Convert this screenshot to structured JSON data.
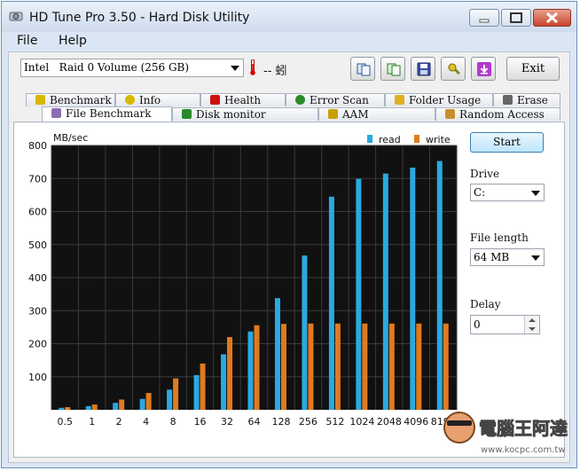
{
  "window": {
    "title": "HD Tune Pro 3.50 - Hard Disk Utility"
  },
  "menu": [
    "File",
    "Help"
  ],
  "toolbar": {
    "drive_select": "Intel   Raid 0 Volume (256 GB)",
    "temperature": "-- 蚓",
    "exit_label": "Exit",
    "tools": [
      "copy-info-icon",
      "copy-screen-icon",
      "save-icon",
      "options-icon",
      "download-icon"
    ]
  },
  "tabs": {
    "row1": [
      {
        "label": "Benchmark",
        "icon": "benchmark-icon",
        "color": "#d8b800"
      },
      {
        "label": "Info",
        "icon": "info-icon",
        "color": "#d8b800"
      },
      {
        "label": "Health",
        "icon": "health-icon",
        "color": "#d01010"
      },
      {
        "label": "Error Scan",
        "icon": "error-scan-icon",
        "color": "#2a8a2a"
      },
      {
        "label": "Folder Usage",
        "icon": "folder-icon",
        "color": "#e0b020"
      },
      {
        "label": "Erase",
        "icon": "erase-icon",
        "color": "#666666"
      }
    ],
    "row2": [
      {
        "label": "File Benchmark",
        "icon": "file-benchmark-icon",
        "color": "#8a6fb0",
        "active": true
      },
      {
        "label": "Disk monitor",
        "icon": "disk-monitor-icon",
        "color": "#2a8a2a"
      },
      {
        "label": "AAM",
        "icon": "speaker-icon",
        "color": "#c8a000"
      },
      {
        "label": "Random Access",
        "icon": "random-access-icon",
        "color": "#c89030"
      }
    ]
  },
  "panel": {
    "start_label": "Start",
    "drive_label": "Drive",
    "drive_value": "C:",
    "file_length_label": "File length",
    "file_length_value": "64 MB",
    "delay_label": "Delay",
    "delay_value": "0"
  },
  "chart_data": {
    "type": "bar",
    "ylabel": "MB/sec",
    "ylim": [
      0,
      800
    ],
    "yticks": [
      100,
      200,
      300,
      400,
      500,
      600,
      700,
      800
    ],
    "categories": [
      "0.5",
      "1",
      "2",
      "4",
      "8",
      "16",
      "32",
      "64",
      "128",
      "256",
      "512",
      "1024",
      "2048",
      "4096",
      "8192"
    ],
    "series": [
      {
        "name": "read",
        "color": "#2aa9e0",
        "values": [
          6,
          11,
          21,
          33,
          61,
          105,
          168,
          237,
          338,
          467,
          645,
          699,
          715,
          733,
          753
        ]
      },
      {
        "name": "write",
        "color": "#e07a1e",
        "values": [
          8,
          16,
          31,
          51,
          95,
          140,
          220,
          256,
          260,
          261,
          261,
          261,
          261,
          261,
          261
        ]
      }
    ],
    "legend": "top-right",
    "background": "#111111",
    "grid": true
  },
  "watermark": {
    "text": "電腦王阿達",
    "url": "www.kocpc.com.tw"
  }
}
